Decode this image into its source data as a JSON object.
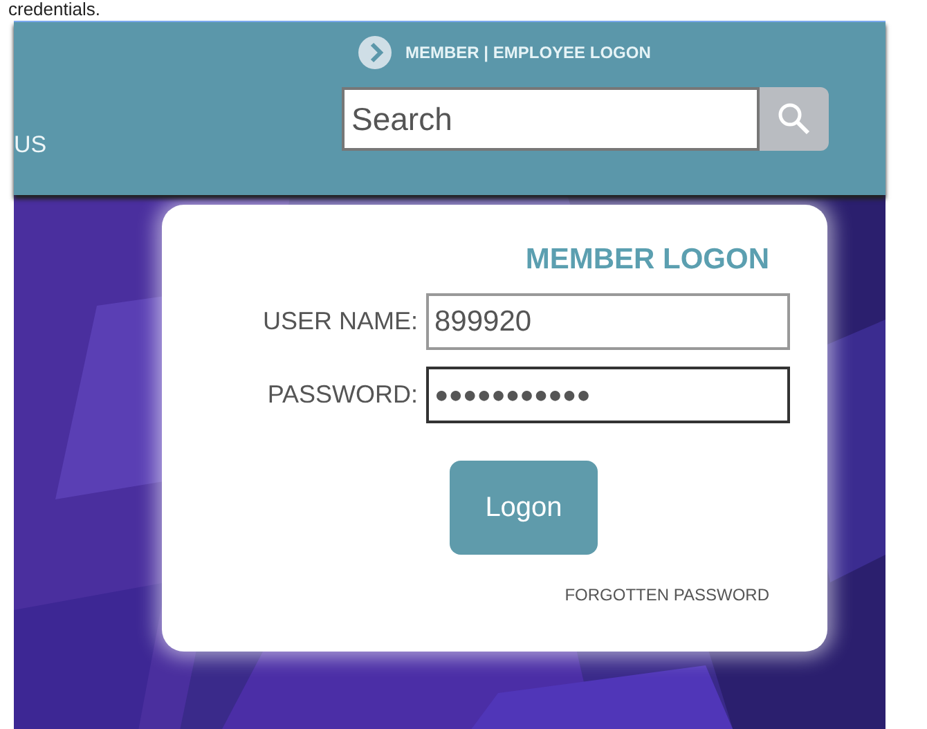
{
  "top_text": "credentials.",
  "header": {
    "nav_item": "US",
    "top_link": "MEMBER | EMPLOYEE LOGON",
    "search": {
      "placeholder": "Search"
    }
  },
  "login": {
    "title": "MEMBER LOGON",
    "fields": [
      {
        "label": "USER NAME:",
        "value": "899920",
        "focused": false
      },
      {
        "label": "PASSWORD:",
        "value": "●●●●●●●●●●●",
        "focused": true
      }
    ],
    "button": "Logon",
    "link": "FORGOTTEN PASSWORD"
  }
}
